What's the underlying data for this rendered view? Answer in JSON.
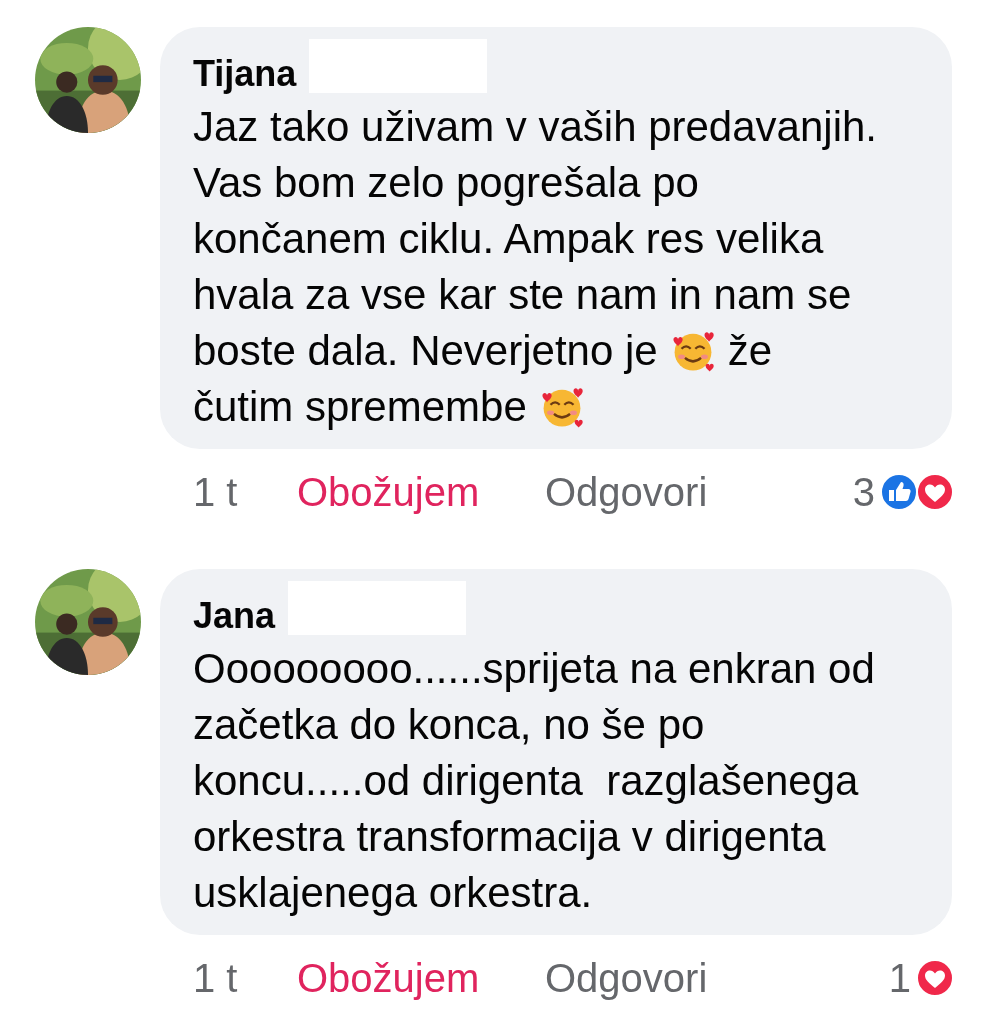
{
  "comments": [
    {
      "author": "Tijana",
      "redacted": true,
      "avatar": {
        "kind": "picture"
      },
      "lines": [
        [
          {
            "kind": "text",
            "text": "Jaz tako uživam v vaših predavanjih."
          }
        ],
        [
          {
            "kind": "text",
            "text": "Vas bom zelo pogrešala po"
          }
        ],
        [
          {
            "kind": "text",
            "text": "končanem ciklu. Ampak res velika"
          }
        ],
        [
          {
            "kind": "text",
            "text": "hvala za vse kar ste nam in nam se"
          }
        ],
        [
          {
            "kind": "text",
            "text": "boste dala. Neverjetno je"
          },
          {
            "kind": "emoji"
          },
          {
            "kind": "text",
            "text": "že"
          }
        ],
        [
          {
            "kind": "text",
            "text": "čutim spremembe"
          },
          {
            "kind": "emoji"
          }
        ]
      ],
      "time": "1 t",
      "love_label": "Obožujem",
      "loved": true,
      "reply_label": "Odgovori",
      "reaction_count": "3",
      "reactions": [
        {
          "kind": "like"
        },
        {
          "kind": "love"
        }
      ]
    },
    {
      "author": "Jana",
      "redacted": true,
      "avatar": {
        "kind": "picture"
      },
      "lines": [
        [
          {
            "kind": "text",
            "text": "Ooooooooo......sprijeta na enkran od"
          }
        ],
        [
          {
            "kind": "text",
            "text": "začetka do konca, no še po"
          }
        ],
        [
          {
            "kind": "text",
            "text": "koncu.....od dirigenta  razglašenega"
          }
        ],
        [
          {
            "kind": "text",
            "text": "orkestra transformacija v dirigenta"
          }
        ],
        [
          {
            "kind": "text",
            "text": "usklajenega orkestra."
          }
        ]
      ],
      "time": "1 t",
      "love_label": "Obožujem",
      "loved": true,
      "reply_label": "Odgovori",
      "reaction_count": "1",
      "reactions": [
        {
          "kind": "love"
        }
      ]
    }
  ]
}
